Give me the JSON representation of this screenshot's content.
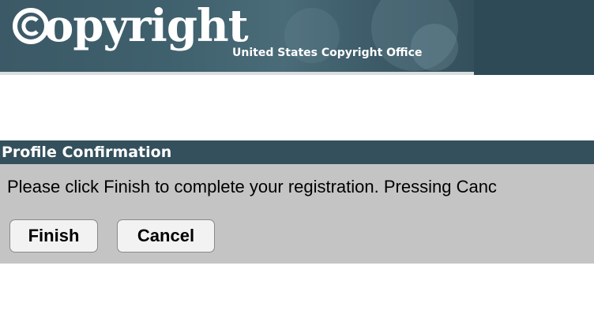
{
  "header": {
    "logo_text": "opyright",
    "logo_subtitle": "United States Copyright Office",
    "logo_icon": "copyright-c-logo"
  },
  "panel": {
    "title": "Profile Confirmation",
    "message": "Please click Finish to complete your registration. Pressing Canc",
    "finish_label": "Finish",
    "cancel_label": "Cancel"
  },
  "colors": {
    "header_bg": "#2f4a57",
    "panel_title_bg": "#34505c",
    "panel_body_bg": "#c4c4c4",
    "button_bg": "#f2f2f2"
  }
}
